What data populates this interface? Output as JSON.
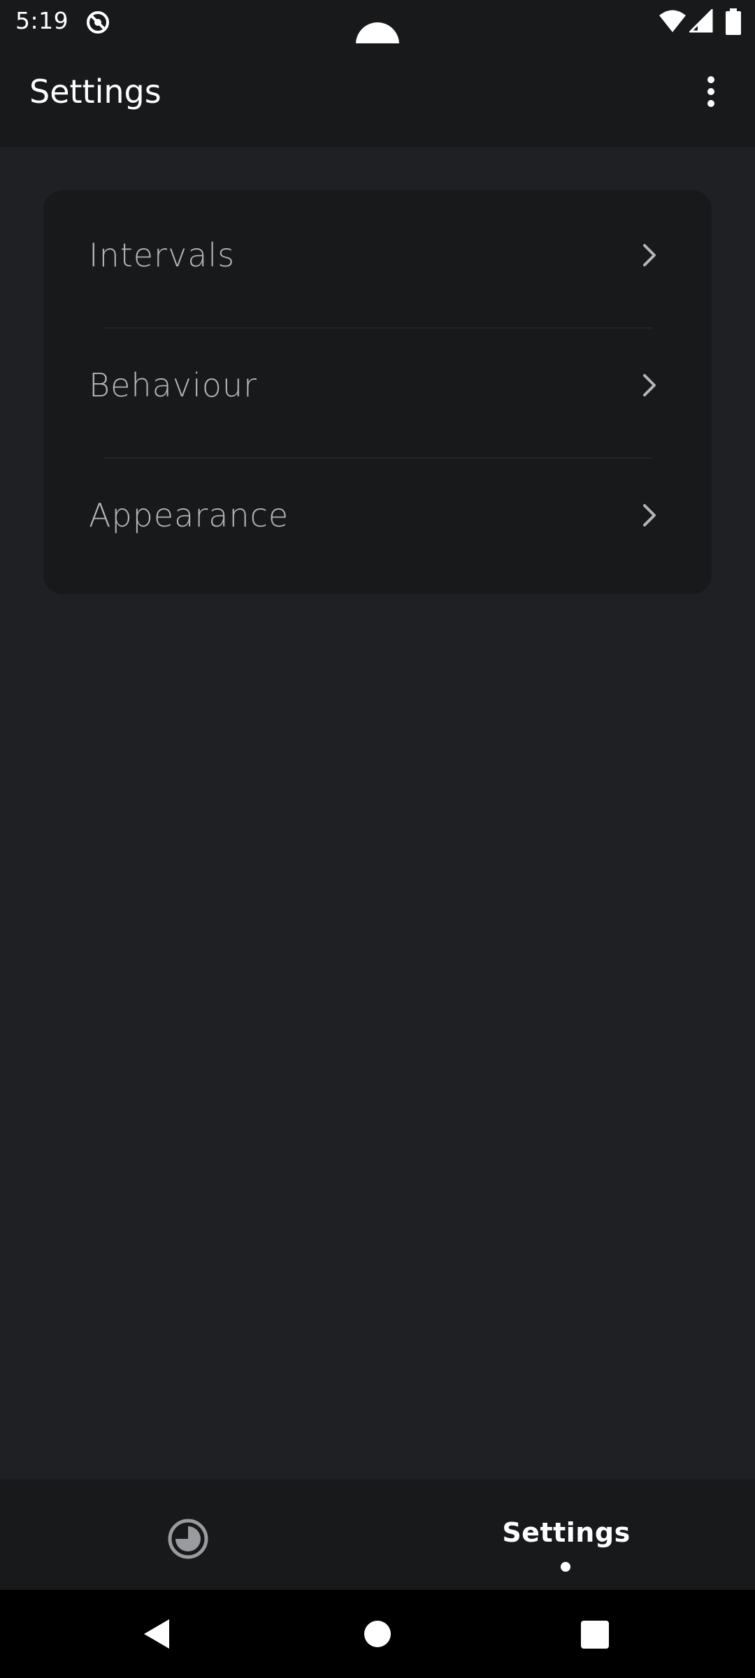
{
  "status_bar": {
    "time": "5:19",
    "icons": [
      "app-notification-icon",
      "wifi-icon",
      "cellular-signal-icon",
      "battery-icon"
    ]
  },
  "app_bar": {
    "title": "Settings",
    "overflow_icon": "more-vert-icon"
  },
  "settings_list": {
    "items": [
      {
        "label": "Intervals",
        "icon": "chevron-right-icon"
      },
      {
        "label": "Behaviour",
        "icon": "chevron-right-icon"
      },
      {
        "label": "Appearance",
        "icon": "chevron-right-icon"
      }
    ]
  },
  "bottom_nav": {
    "items": [
      {
        "icon": "timer-icon",
        "label": ""
      },
      {
        "label": "Settings",
        "selected": true
      }
    ]
  },
  "system_nav": {
    "buttons": [
      "back-icon",
      "home-icon",
      "recents-icon"
    ]
  },
  "colors": {
    "background": "#1f2024",
    "surface": "#18191b",
    "text_primary": "#ffffff",
    "text_secondary": "#b4b5b8"
  }
}
